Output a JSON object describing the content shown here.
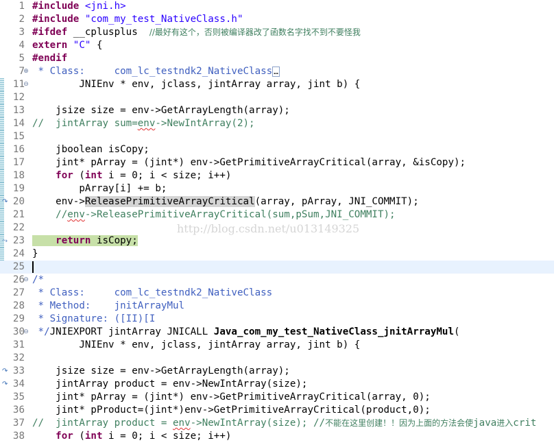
{
  "editor": {
    "lines": [
      {
        "n": "1",
        "segs": [
          {
            "t": "#include ",
            "c": "kw"
          },
          {
            "t": "<jni.h>",
            "c": "str"
          }
        ]
      },
      {
        "n": "2",
        "segs": [
          {
            "t": "#include ",
            "c": "kw"
          },
          {
            "t": "\"com_my_test_NativeClass.h\"",
            "c": "str"
          }
        ]
      },
      {
        "n": "3",
        "segs": [
          {
            "t": "#ifdef ",
            "c": "kw"
          },
          {
            "t": "__cplusplus  "
          },
          {
            "t": "//最好有这个，否则被编译器改了函数名字找不到不要怪我",
            "c": "cm cn"
          }
        ]
      },
      {
        "n": "4",
        "segs": [
          {
            "t": "extern ",
            "c": "kw"
          },
          {
            "t": "\"C\"",
            "c": "str"
          },
          {
            "t": " {"
          }
        ]
      },
      {
        "n": "5",
        "segs": [
          {
            "t": "#endif",
            "c": "kw"
          }
        ]
      },
      {
        "n": "7",
        "fold": "plus",
        "segs": [
          {
            "t": " * Class:     com_lc_testndk2_NativeClass",
            "c": "doc"
          },
          {
            "t": "…",
            "c": "boxed"
          }
        ]
      },
      {
        "n": "11",
        "fold": "minus",
        "ruler": true,
        "segs": [
          {
            "t": "        JNIEnv * env, jclass, jintArray array, jint b) {"
          }
        ]
      },
      {
        "n": "12",
        "ruler": true,
        "segs": []
      },
      {
        "n": "13",
        "ruler": true,
        "segs": [
          {
            "t": "    jsize size = env->GetArrayLength(array);"
          }
        ]
      },
      {
        "n": "14",
        "ruler": true,
        "segs": [
          {
            "t": "//  jintArray sum=",
            "c": "cm"
          },
          {
            "t": "env",
            "c": "cm squig"
          },
          {
            "t": "->NewIntArray(2);",
            "c": "cm"
          }
        ]
      },
      {
        "n": "15",
        "ruler": true,
        "segs": []
      },
      {
        "n": "16",
        "ruler": true,
        "segs": [
          {
            "t": "    jboolean isCopy;"
          }
        ]
      },
      {
        "n": "17",
        "ruler": true,
        "segs": [
          {
            "t": "    jint* pArray = (jint*) env->GetPrimitiveArrayCritical(array, &isCopy);"
          }
        ]
      },
      {
        "n": "18",
        "ruler": true,
        "segs": [
          {
            "t": "    "
          },
          {
            "t": "for",
            "c": "kw"
          },
          {
            "t": " ("
          },
          {
            "t": "int",
            "c": "kw"
          },
          {
            "t": " i = 0; i < size; i++)"
          }
        ]
      },
      {
        "n": "19",
        "ruler": true,
        "segs": [
          {
            "t": "        pArray[i] += b;"
          }
        ]
      },
      {
        "n": "20",
        "ruler": true,
        "mark": "arrow",
        "segs": [
          {
            "t": "    env->"
          },
          {
            "t": "ReleasePrimitiveArrayCritical",
            "c": "hl"
          },
          {
            "t": "(array, pArray, JNI_COMMIT);"
          }
        ]
      },
      {
        "n": "21",
        "ruler": true,
        "segs": [
          {
            "t": "    //",
            "c": "cm"
          },
          {
            "t": "env",
            "c": "cm squig"
          },
          {
            "t": "->ReleasePrimitiveArrayCritical(sum,pSum,JNI_COMMIT);",
            "c": "cm"
          }
        ]
      },
      {
        "n": "22",
        "ruler": true,
        "segs": []
      },
      {
        "n": "23",
        "ruler": true,
        "mark": "arrow2",
        "segs": [
          {
            "t": "    ",
            "c": "ret-hl"
          },
          {
            "t": "return",
            "c": "kw ret-hl"
          },
          {
            "t": " isCopy;",
            "c": "ret-hl"
          }
        ]
      },
      {
        "n": "24",
        "ruler": true,
        "segs": [
          {
            "t": "}"
          }
        ]
      },
      {
        "n": "25",
        "current": true,
        "caret": true,
        "segs": []
      },
      {
        "n": "26",
        "fold": "minus",
        "segs": [
          {
            "t": "/*",
            "c": "doc"
          }
        ]
      },
      {
        "n": "27",
        "segs": [
          {
            "t": " * Class:     com_lc_testndk2_NativeClass",
            "c": "doc"
          }
        ]
      },
      {
        "n": "28",
        "segs": [
          {
            "t": " * Method:    jnitArrayMul",
            "c": "doc"
          }
        ]
      },
      {
        "n": "29",
        "segs": [
          {
            "t": " * Signature: ([II)[I",
            "c": "doc"
          }
        ]
      },
      {
        "n": "30",
        "fold": "minus",
        "segs": [
          {
            "t": " */",
            "c": "doc"
          },
          {
            "t": "JNIEXPORT jintArray JNICALL "
          },
          {
            "t": "Java_com_my_test_NativeClass_jnitArrayMul",
            "c": "fn"
          },
          {
            "t": "("
          }
        ]
      },
      {
        "n": "31",
        "segs": [
          {
            "t": "        JNIEnv * env, jclass, jintArray array, jint b) {"
          }
        ]
      },
      {
        "n": "32",
        "segs": []
      },
      {
        "n": "33",
        "mark": "arrow",
        "segs": [
          {
            "t": "    jsize size = env->GetArrayLength(array);"
          }
        ]
      },
      {
        "n": "34",
        "mark": "arrow",
        "segs": [
          {
            "t": "    jintArray product = env->NewIntArray(size);"
          }
        ]
      },
      {
        "n": "35",
        "segs": [
          {
            "t": "    jint* pArray = (jint*) env->GetPrimitiveArrayCritical(array, 0);"
          }
        ]
      },
      {
        "n": "36",
        "segs": [
          {
            "t": "    jint* pProduct=(jint*)env->GetPrimitiveArrayCritical(product,0);"
          }
        ]
      },
      {
        "n": "37",
        "segs": [
          {
            "t": "//  jintArray product = ",
            "c": "cm"
          },
          {
            "t": "env",
            "c": "cm squig"
          },
          {
            "t": "->NewIntArray(size); //",
            "c": "cm"
          },
          {
            "t": "不能在这里创建！！因为上面的方法会使",
            "c": "cm cn"
          },
          {
            "t": "java",
            "c": "cm"
          },
          {
            "t": "进入",
            "c": "cm cn"
          },
          {
            "t": "crit",
            "c": "cm"
          }
        ]
      },
      {
        "n": "38",
        "segs": [
          {
            "t": "    "
          },
          {
            "t": "for",
            "c": "kw"
          },
          {
            "t": " ("
          },
          {
            "t": "int",
            "c": "kw"
          },
          {
            "t": " i = 0; i < size; i++)"
          }
        ]
      }
    ]
  },
  "watermark": "http://blog.csdn.net/u013149325",
  "colors": {
    "keyword": "#7f0055",
    "string": "#2a00ff",
    "comment": "#3f7f5f",
    "javadoc": "#3f5fbf",
    "line_number": "#787878",
    "current_line": "#e8f2fe",
    "occurrence_highlight": "#d4d4d4",
    "return_highlight": "#c7e0a8"
  },
  "icons": {
    "fold_expand": "plus-circle-icon",
    "fold_collapse": "minus-circle-icon",
    "override_marker": "override-arrow-icon"
  }
}
